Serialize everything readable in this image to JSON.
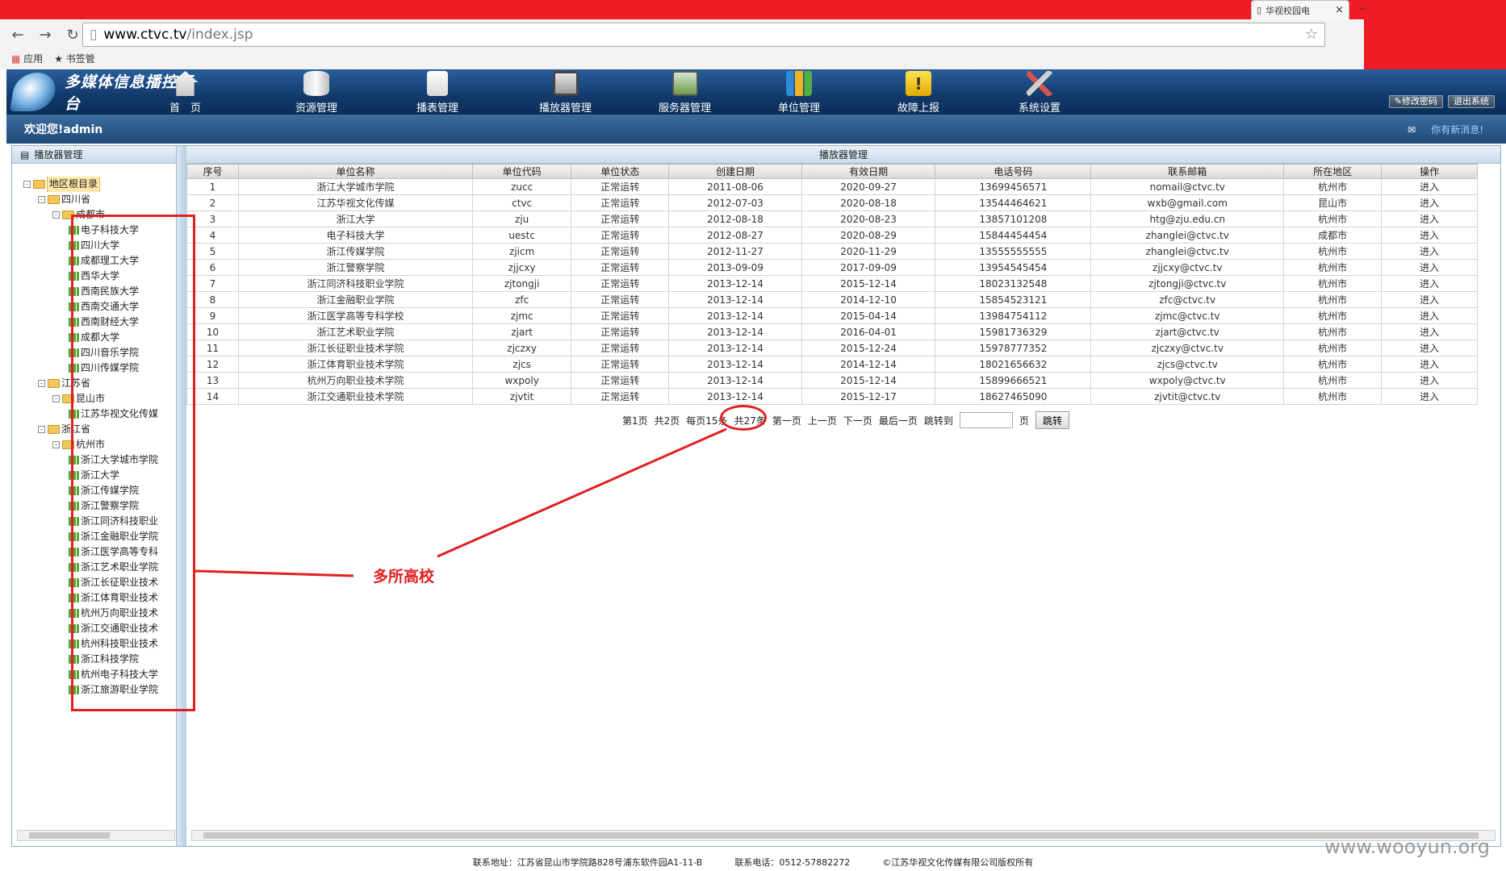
{
  "browser": {
    "tab_title": "华视校园电",
    "url_host": "www.ctvc.tv",
    "url_path": "/index.jsp",
    "bookmarks": [
      "应用",
      "书签管"
    ]
  },
  "header": {
    "title": "多媒体信息播控平台",
    "menu": [
      "首　页",
      "资源管理",
      "播表管理",
      "播放器管理",
      "服务器管理",
      "单位管理",
      "故障上报",
      "系统设置"
    ],
    "change_password": "修改密码",
    "logout": "退出系统",
    "welcome": "欢迎您!admin",
    "new_message": "你有新消息!"
  },
  "left_panel": {
    "title": "播放器管理",
    "tree": [
      {
        "label": "地区根目录",
        "level": 0,
        "type": "folder",
        "toggle": "-",
        "selected": true
      },
      {
        "label": "四川省",
        "level": 1,
        "type": "folder",
        "toggle": "-"
      },
      {
        "label": "成都市",
        "level": 2,
        "type": "folder",
        "toggle": "-"
      },
      {
        "label": "电子科技大学",
        "level": 3,
        "type": "leaf"
      },
      {
        "label": "四川大学",
        "level": 3,
        "type": "leaf"
      },
      {
        "label": "成都理工大学",
        "level": 3,
        "type": "leaf"
      },
      {
        "label": "西华大学",
        "level": 3,
        "type": "leaf"
      },
      {
        "label": "西南民族大学",
        "level": 3,
        "type": "leaf"
      },
      {
        "label": "西南交通大学",
        "level": 3,
        "type": "leaf"
      },
      {
        "label": "西南财经大学",
        "level": 3,
        "type": "leaf"
      },
      {
        "label": "成都大学",
        "level": 3,
        "type": "leaf"
      },
      {
        "label": "四川音乐学院",
        "level": 3,
        "type": "leaf"
      },
      {
        "label": "四川传媒学院",
        "level": 3,
        "type": "leaf"
      },
      {
        "label": "江苏省",
        "level": 1,
        "type": "folder",
        "toggle": "-"
      },
      {
        "label": "昆山市",
        "level": 2,
        "type": "folder",
        "toggle": "-"
      },
      {
        "label": "江苏华视文化传媒",
        "level": 3,
        "type": "leaf"
      },
      {
        "label": "浙江省",
        "level": 1,
        "type": "folder",
        "toggle": "-"
      },
      {
        "label": "杭州市",
        "level": 2,
        "type": "folder",
        "toggle": "-"
      },
      {
        "label": "浙江大学城市学院",
        "level": 3,
        "type": "leaf"
      },
      {
        "label": "浙江大学",
        "level": 3,
        "type": "leaf"
      },
      {
        "label": "浙江传媒学院",
        "level": 3,
        "type": "leaf"
      },
      {
        "label": "浙江警察学院",
        "level": 3,
        "type": "leaf"
      },
      {
        "label": "浙江同济科技职业",
        "level": 3,
        "type": "leaf"
      },
      {
        "label": "浙江金融职业学院",
        "level": 3,
        "type": "leaf"
      },
      {
        "label": "浙江医学高等专科",
        "level": 3,
        "type": "leaf"
      },
      {
        "label": "浙江艺术职业学院",
        "level": 3,
        "type": "leaf"
      },
      {
        "label": "浙江长征职业技术",
        "level": 3,
        "type": "leaf"
      },
      {
        "label": "浙江体育职业技术",
        "level": 3,
        "type": "leaf"
      },
      {
        "label": "杭州万向职业技术",
        "level": 3,
        "type": "leaf"
      },
      {
        "label": "浙江交通职业技术",
        "level": 3,
        "type": "leaf"
      },
      {
        "label": "杭州科技职业技术",
        "level": 3,
        "type": "leaf"
      },
      {
        "label": "浙江科技学院",
        "level": 3,
        "type": "leaf"
      },
      {
        "label": "杭州电子科技大学",
        "level": 3,
        "type": "leaf"
      },
      {
        "label": "浙江旅游职业学院",
        "level": 3,
        "type": "leaf"
      }
    ]
  },
  "main": {
    "title": "播放器管理",
    "columns": [
      "序号",
      "单位名称",
      "单位代码",
      "单位状态",
      "创建日期",
      "有效日期",
      "电话号码",
      "联系邮箱",
      "所在地区",
      "操作"
    ],
    "rows": [
      [
        "1",
        "浙江大学城市学院",
        "zucc",
        "正常运转",
        "2011-08-06",
        "2020-09-27",
        "13699456571",
        "nomail@ctvc.tv",
        "杭州市",
        "进入"
      ],
      [
        "2",
        "江苏华视文化传媒",
        "ctvc",
        "正常运转",
        "2012-07-03",
        "2020-08-18",
        "13544464621",
        "wxb@gmail.com",
        "昆山市",
        "进入"
      ],
      [
        "3",
        "浙江大学",
        "zju",
        "正常运转",
        "2012-08-18",
        "2020-08-23",
        "13857101208",
        "htg@zju.edu.cn",
        "杭州市",
        "进入"
      ],
      [
        "4",
        "电子科技大学",
        "uestc",
        "正常运转",
        "2012-08-27",
        "2020-08-29",
        "15844454454",
        "zhanglei@ctvc.tv",
        "成都市",
        "进入"
      ],
      [
        "5",
        "浙江传媒学院",
        "zjicm",
        "正常运转",
        "2012-11-27",
        "2020-11-29",
        "13555555555",
        "zhanglei@ctvc.tv",
        "杭州市",
        "进入"
      ],
      [
        "6",
        "浙江警察学院",
        "zjjcxy",
        "正常运转",
        "2013-09-09",
        "2017-09-09",
        "13954545454",
        "zjjcxy@ctvc.tv",
        "杭州市",
        "进入"
      ],
      [
        "7",
        "浙江同济科技职业学院",
        "zjtongji",
        "正常运转",
        "2013-12-14",
        "2015-12-14",
        "18023132548",
        "zjtongji@ctvc.tv",
        "杭州市",
        "进入"
      ],
      [
        "8",
        "浙江金融职业学院",
        "zfc",
        "正常运转",
        "2013-12-14",
        "2014-12-10",
        "15854523121",
        "zfc@ctvc.tv",
        "杭州市",
        "进入"
      ],
      [
        "9",
        "浙江医学高等专科学校",
        "zjmc",
        "正常运转",
        "2013-12-14",
        "2015-04-14",
        "13984754112",
        "zjmc@ctvc.tv",
        "杭州市",
        "进入"
      ],
      [
        "10",
        "浙江艺术职业学院",
        "zjart",
        "正常运转",
        "2013-12-14",
        "2016-04-01",
        "15981736329",
        "zjart@ctvc.tv",
        "杭州市",
        "进入"
      ],
      [
        "11",
        "浙江长征职业技术学院",
        "zjczxy",
        "正常运转",
        "2013-12-14",
        "2015-12-24",
        "15978777352",
        "zjczxy@ctvc.tv",
        "杭州市",
        "进入"
      ],
      [
        "12",
        "浙江体育职业技术学院",
        "zjcs",
        "正常运转",
        "2013-12-14",
        "2014-12-14",
        "18021656632",
        "zjcs@ctvc.tv",
        "杭州市",
        "进入"
      ],
      [
        "13",
        "杭州万向职业技术学院",
        "wxpoly",
        "正常运转",
        "2013-12-14",
        "2015-12-14",
        "15899666521",
        "wxpoly@ctvc.tv",
        "杭州市",
        "进入"
      ],
      [
        "14",
        "浙江交通职业技术学院",
        "zjvtit",
        "正常运转",
        "2013-12-14",
        "2015-12-17",
        "18627465090",
        "zjvtit@ctvc.tv",
        "杭州市",
        "进入"
      ]
    ],
    "pager": {
      "page": "第1页",
      "total_pages": "共2页",
      "per_page": "每页15条",
      "total": "共27条",
      "first": "第一页",
      "prev": "上一页",
      "next": "下一页",
      "last": "最后一页",
      "jump_to": "跳转到",
      "page_unit": "页",
      "go": "跳转"
    }
  },
  "footer": {
    "address": "联系地址：江苏省昆山市学院路828号浦东软件园A1-11-B",
    "phone": "联系电话：0512-57882272",
    "copyright": "©江苏华视文化传媒有限公司版权所有"
  },
  "annotation": {
    "text": "多所高校",
    "color": "#e02020"
  },
  "watermark": "www.wooyun.org",
  "colors": {
    "header_bg": "#1a4a80",
    "accent_red": "#ee1c25"
  }
}
